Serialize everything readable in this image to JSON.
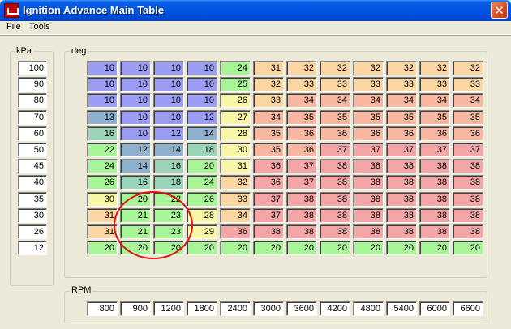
{
  "window": {
    "title": "Ignition Advance Main Table",
    "close_glyph": "✕"
  },
  "menu": [
    {
      "label": "File"
    },
    {
      "label": "Tools"
    }
  ],
  "kpa_group": {
    "label": "kPa",
    "values": [
      "100",
      "90",
      "80",
      "70",
      "60",
      "50",
      "45",
      "40",
      "35",
      "30",
      "26",
      "12"
    ]
  },
  "deg_group": {
    "label": "deg"
  },
  "rpm_group": {
    "label": "RPM",
    "values": [
      "800",
      "900",
      "1200",
      "1800",
      "2400",
      "3000",
      "3600",
      "4200",
      "4800",
      "5400",
      "6000",
      "6600"
    ]
  },
  "table": {
    "rows": [
      [
        "10",
        "10",
        "10",
        "10",
        "24",
        "31",
        "32",
        "32",
        "32",
        "32",
        "32",
        "32"
      ],
      [
        "10",
        "10",
        "10",
        "10",
        "25",
        "32",
        "33",
        "33",
        "33",
        "33",
        "33",
        "33"
      ],
      [
        "10",
        "10",
        "10",
        "10",
        "26",
        "33",
        "34",
        "34",
        "34",
        "34",
        "34",
        "34"
      ],
      [
        "13",
        "10",
        "10",
        "12",
        "27",
        "34",
        "35",
        "35",
        "35",
        "35",
        "35",
        "35"
      ],
      [
        "16",
        "10",
        "12",
        "14",
        "28",
        "35",
        "36",
        "36",
        "36",
        "36",
        "36",
        "36"
      ],
      [
        "22",
        "12",
        "14",
        "18",
        "30",
        "35",
        "36",
        "37",
        "37",
        "37",
        "37",
        "37"
      ],
      [
        "24",
        "14",
        "16",
        "20",
        "31",
        "36",
        "37",
        "38",
        "38",
        "38",
        "38",
        "38"
      ],
      [
        "26",
        "16",
        "18",
        "24",
        "32",
        "36",
        "37",
        "38",
        "38",
        "38",
        "38",
        "38"
      ],
      [
        "30",
        "20",
        "22",
        "26",
        "33",
        "37",
        "38",
        "38",
        "38",
        "38",
        "38",
        "38"
      ],
      [
        "31",
        "21",
        "23",
        "28",
        "34",
        "37",
        "38",
        "38",
        "38",
        "38",
        "38",
        "38"
      ],
      [
        "31",
        "21",
        "23",
        "29",
        "36",
        "38",
        "38",
        "38",
        "38",
        "38",
        "38",
        "38"
      ],
      [
        "20",
        "20",
        "20",
        "20",
        "20",
        "20",
        "20",
        "20",
        "20",
        "20",
        "20",
        "20"
      ]
    ],
    "color_classes": [
      [
        "blue",
        "blue",
        "blue",
        "blue",
        "green",
        "peach",
        "peach",
        "peach",
        "peach",
        "peach",
        "peach",
        "peach"
      ],
      [
        "blue",
        "blue",
        "blue",
        "blue",
        "green",
        "peach",
        "peach",
        "peach",
        "peach",
        "peach",
        "peach",
        "peach"
      ],
      [
        "blue",
        "blue",
        "blue",
        "blue",
        "yellow",
        "peach",
        "salmon",
        "salmon",
        "salmon",
        "salmon",
        "salmon",
        "salmon"
      ],
      [
        "steel",
        "blue",
        "blue",
        "blue",
        "yellow",
        "salmon",
        "salmon",
        "salmon",
        "salmon",
        "salmon",
        "salmon",
        "salmon"
      ],
      [
        "teal",
        "blue",
        "blue",
        "steel",
        "yellow",
        "salmon",
        "salmon",
        "salmon",
        "salmon",
        "salmon",
        "salmon",
        "salmon"
      ],
      [
        "green",
        "steel",
        "steel",
        "teal",
        "yellow",
        "salmon",
        "salmon",
        "pink",
        "pink",
        "pink",
        "pink",
        "pink"
      ],
      [
        "green",
        "steel",
        "teal",
        "green",
        "yellow",
        "pink",
        "pink",
        "pink",
        "pink",
        "pink",
        "pink",
        "pink"
      ],
      [
        "green",
        "teal",
        "teal",
        "green",
        "peach",
        "pink",
        "pink",
        "pink",
        "pink",
        "pink",
        "pink",
        "pink"
      ],
      [
        "yellow",
        "green",
        "green",
        "green",
        "peach",
        "pink",
        "pink",
        "pink",
        "pink",
        "pink",
        "pink",
        "pink"
      ],
      [
        "peach",
        "green",
        "green",
        "yellow",
        "peach",
        "pink",
        "pink",
        "pink",
        "pink",
        "pink",
        "pink",
        "pink"
      ],
      [
        "peach",
        "green",
        "green",
        "yellow",
        "pink",
        "pink",
        "pink",
        "pink",
        "pink",
        "pink",
        "pink",
        "pink"
      ],
      [
        "green",
        "green",
        "green",
        "green",
        "green",
        "green",
        "green",
        "green",
        "green",
        "green",
        "green",
        "green"
      ]
    ]
  }
}
